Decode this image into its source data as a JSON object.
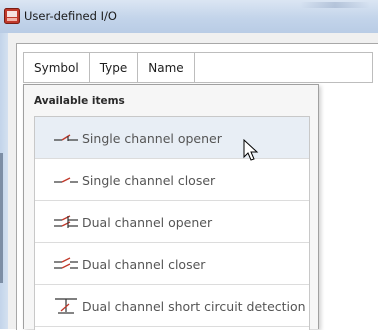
{
  "window": {
    "title": "User-defined I/O",
    "icon": "app-icon"
  },
  "table": {
    "columns": [
      "Symbol",
      "Type",
      "Name"
    ]
  },
  "dropdown": {
    "title": "Available items",
    "items": [
      {
        "label": "Single channel opener",
        "icon": "single-channel-opener-icon",
        "hover": true
      },
      {
        "label": "Single channel closer",
        "icon": "single-channel-closer-icon",
        "hover": false
      },
      {
        "label": "Dual channel opener",
        "icon": "dual-channel-opener-icon",
        "hover": false
      },
      {
        "label": "Dual channel closer",
        "icon": "dual-channel-closer-icon",
        "hover": false
      },
      {
        "label": "Dual channel short circuit detection",
        "icon": "short-circuit-detection-icon",
        "hover": false
      }
    ]
  },
  "colors": {
    "title_bar": "#c3d4ea",
    "symbol_red": "#c0392b",
    "symbol_dark": "#333333",
    "hover_row": "#e8eef5"
  }
}
